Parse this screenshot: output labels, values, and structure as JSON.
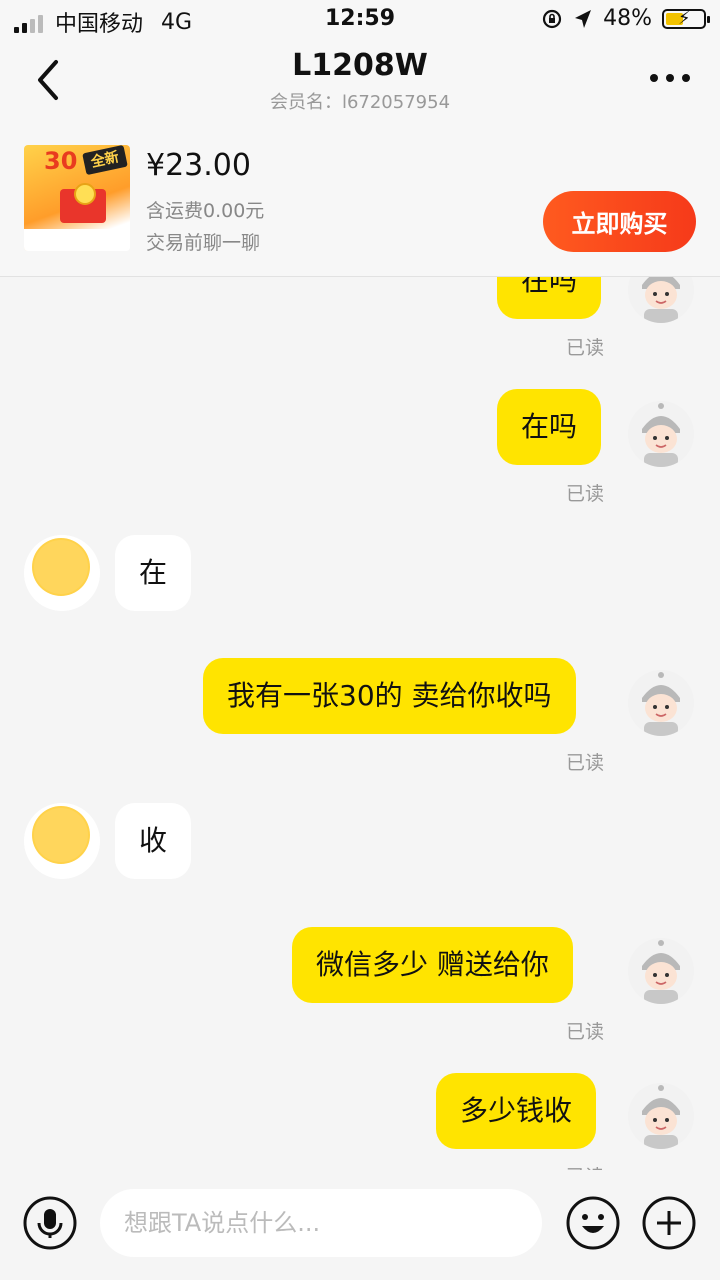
{
  "status_bar": {
    "carrier": "中国移动",
    "network": "4G",
    "time": "12:59",
    "battery": "48%",
    "battery_level": 0.48
  },
  "header": {
    "title": "L1208W",
    "subtitle": "会员名：l672057954"
  },
  "product": {
    "thumb_badge": "30",
    "thumb_tag": "全新",
    "price": "¥23.00",
    "shipping": "含运费0.00元",
    "note": "交易前聊一聊",
    "buy_label": "立即购买"
  },
  "messages": [
    {
      "side": "me",
      "text": "在吗",
      "read": "已读"
    },
    {
      "side": "me",
      "text": "在吗",
      "read": "已读"
    },
    {
      "side": "them",
      "text": "在"
    },
    {
      "side": "me",
      "text": "我有一张30的 卖给你收吗",
      "read": "已读"
    },
    {
      "side": "them",
      "text": "收"
    },
    {
      "side": "me",
      "text": "微信多少 赠送给你",
      "read": "已读"
    },
    {
      "side": "me",
      "text": "多少钱收",
      "read": "已读"
    }
  ],
  "input": {
    "placeholder": "想跟TA说点什么..."
  },
  "icons": {
    "back": "chevron-left-icon",
    "more": "more-icon",
    "voice": "microphone-icon",
    "emoji": "emoji-icon",
    "add": "plus-icon"
  },
  "colors": {
    "my_bubble": "#ffe400",
    "buy_button": "#f94a1c",
    "background": "#f5f5f5"
  }
}
